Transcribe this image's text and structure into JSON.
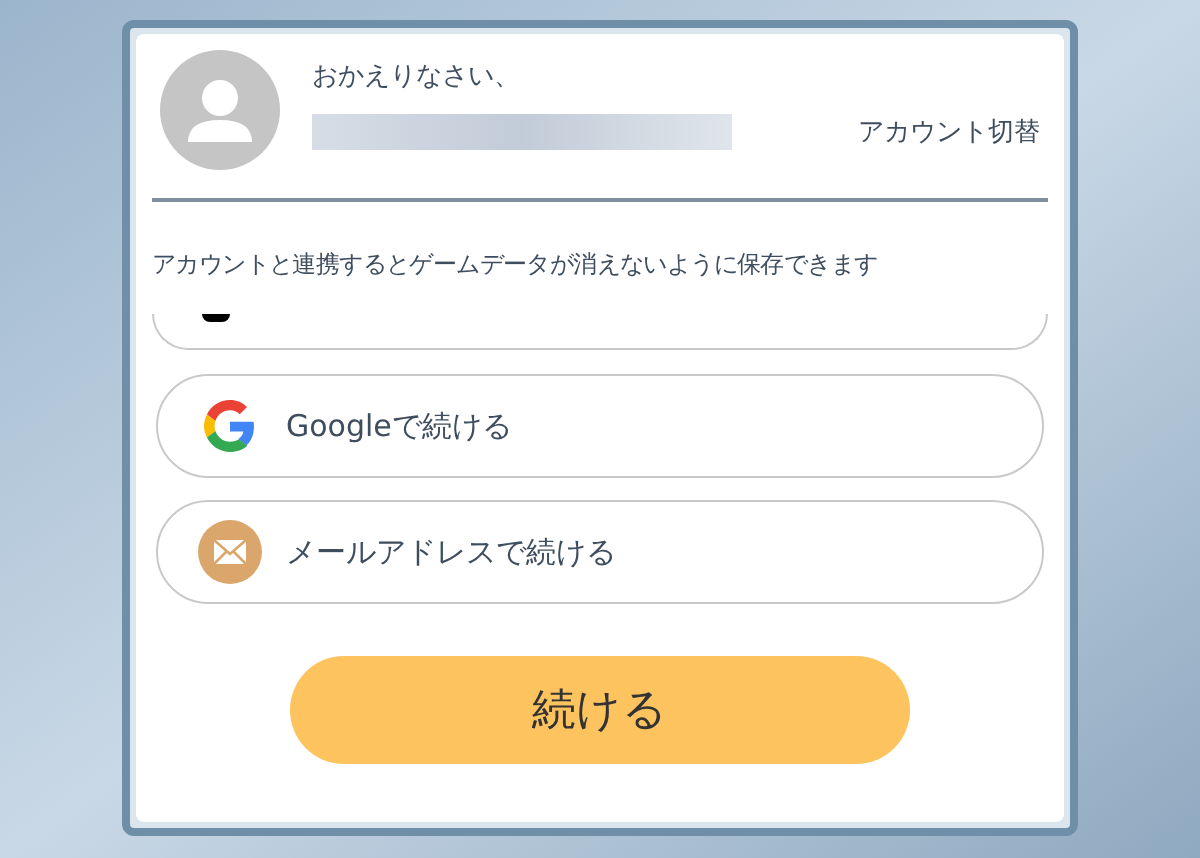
{
  "header": {
    "greeting": "おかえりなさい、",
    "switch_link": "アカウント切替"
  },
  "notice": "アカウントと連携するとゲームデータが消えないように保存できます",
  "options": [
    {
      "kind": "google",
      "label": "Googleで続ける"
    },
    {
      "kind": "email",
      "label": "メールアドレスで続ける"
    }
  ],
  "continue_button": "続ける"
}
